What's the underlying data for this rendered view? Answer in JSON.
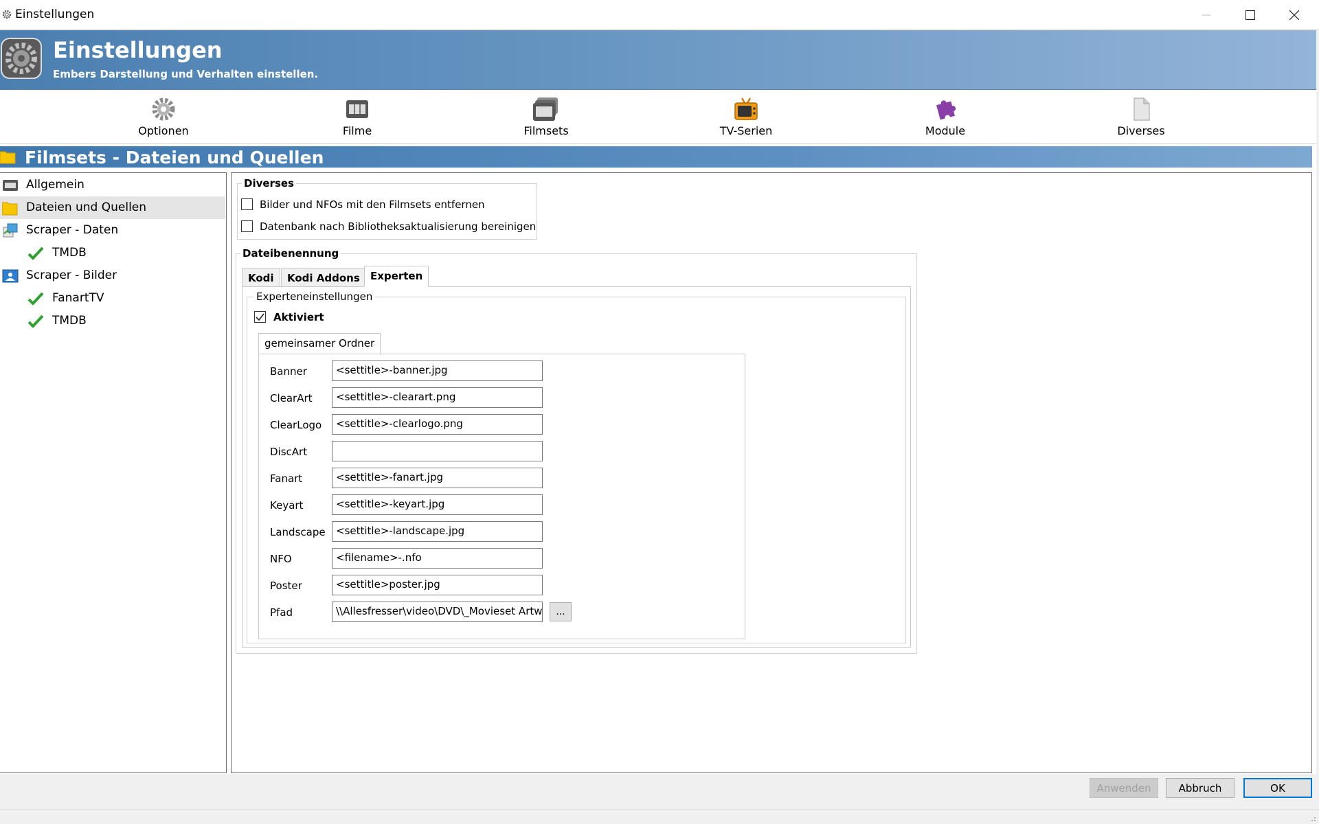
{
  "window": {
    "title": "Einstellungen"
  },
  "header": {
    "title": "Einstellungen",
    "subtitle": "Embers Darstellung und Verhalten einstellen."
  },
  "toolbar": {
    "items": [
      {
        "label": "Optionen",
        "icon": "gear-icon"
      },
      {
        "label": "Filme",
        "icon": "film-icon"
      },
      {
        "label": "Filmsets",
        "icon": "filmsets-icon"
      },
      {
        "label": "TV-Serien",
        "icon": "tv-icon"
      },
      {
        "label": "Module",
        "icon": "puzzle-icon"
      },
      {
        "label": "Diverses",
        "icon": "document-icon"
      }
    ]
  },
  "section": {
    "title": "Filmsets - Dateien und Quellen"
  },
  "sidebar": {
    "items": [
      {
        "label": "Allgemein",
        "icon": "film-icon"
      },
      {
        "label": "Dateien und Quellen",
        "icon": "folder-icon",
        "selected": true
      },
      {
        "label": "Scraper - Daten",
        "icon": "scraper-data-icon"
      },
      {
        "label": "TMDB",
        "icon": "checkmark-icon"
      },
      {
        "label": "Scraper - Bilder",
        "icon": "scraper-images-icon"
      },
      {
        "label": "FanartTV",
        "icon": "checkmark-icon"
      },
      {
        "label": "TMDB",
        "icon": "checkmark-icon"
      }
    ]
  },
  "diverses": {
    "title": "Diverses",
    "options": [
      {
        "label": "Bilder und NFOs mit den Filmsets entfernen",
        "checked": false
      },
      {
        "label": "Datenbank nach Bibliotheksaktualisierung bereinigen",
        "checked": false
      }
    ]
  },
  "naming": {
    "title": "Dateibenennung",
    "tabs": [
      "Kodi",
      "Kodi Addons",
      "Experten"
    ],
    "active_tab": "Experten",
    "expert": {
      "title": "Experteneinstellungen",
      "enabled_label": "Aktiviert",
      "enabled": true,
      "subtab": "gemeinsamer Ordner",
      "fields": [
        {
          "label": "Banner",
          "value": "<settitle>-banner.jpg"
        },
        {
          "label": "ClearArt",
          "value": "<settitle>-clearart.png"
        },
        {
          "label": "ClearLogo",
          "value": "<settitle>-clearlogo.png"
        },
        {
          "label": "DiscArt",
          "value": ""
        },
        {
          "label": "Fanart",
          "value": "<settitle>-fanart.jpg"
        },
        {
          "label": "Keyart",
          "value": "<settitle>-keyart.jpg"
        },
        {
          "label": "Landscape",
          "value": "<settitle>-landscape.jpg"
        },
        {
          "label": "NFO",
          "value": "<filename>-.nfo"
        },
        {
          "label": "Poster",
          "value": "<settitle>poster.jpg"
        },
        {
          "label": "Pfad",
          "value": "\\\\Allesfresser\\video\\DVD\\_Movieset Artwo"
        }
      ],
      "browse_label": "..."
    }
  },
  "buttons": {
    "apply": "Anwenden",
    "cancel": "Abbruch",
    "ok": "OK"
  }
}
